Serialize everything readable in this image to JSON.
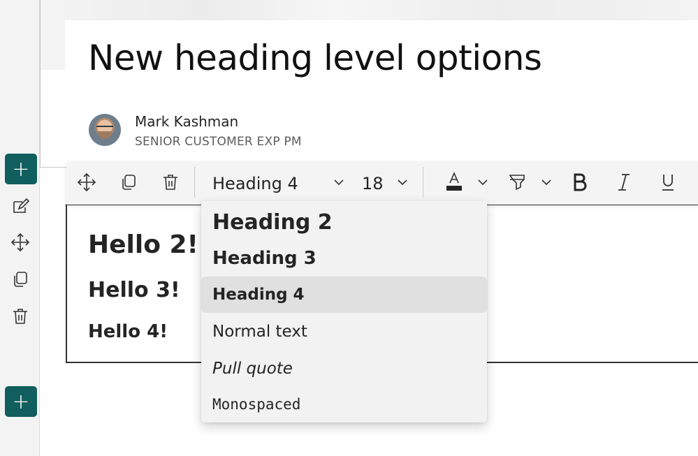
{
  "page": {
    "title": "New heading level options"
  },
  "author": {
    "name": "Mark Kashman",
    "role": "SENIOR CUSTOMER EXP PM"
  },
  "rail": {
    "add_label": "+",
    "icons": [
      "edit-icon",
      "move-icon",
      "duplicate-icon",
      "delete-icon"
    ]
  },
  "toolbar": {
    "style_value": "Heading 4",
    "size_value": "18",
    "icons": [
      "move-icon",
      "duplicate-icon",
      "delete-icon",
      "font-color-icon",
      "highlight-icon",
      "bold-icon",
      "italic-icon",
      "underline-icon"
    ],
    "font_color": "#242424",
    "highlight_color": "#ffffff"
  },
  "content": {
    "h2": "Hello 2!",
    "h3": "Hello 3!",
    "h4": "Hello 4!"
  },
  "dropdown": {
    "options": [
      {
        "label": "Heading 2"
      },
      {
        "label": "Heading 3"
      },
      {
        "label": "Heading 4",
        "selected": true
      },
      {
        "label": "Normal text"
      },
      {
        "label": "Pull quote"
      },
      {
        "label": "Monospaced"
      }
    ]
  },
  "colors": {
    "accent": "#105e5d"
  }
}
